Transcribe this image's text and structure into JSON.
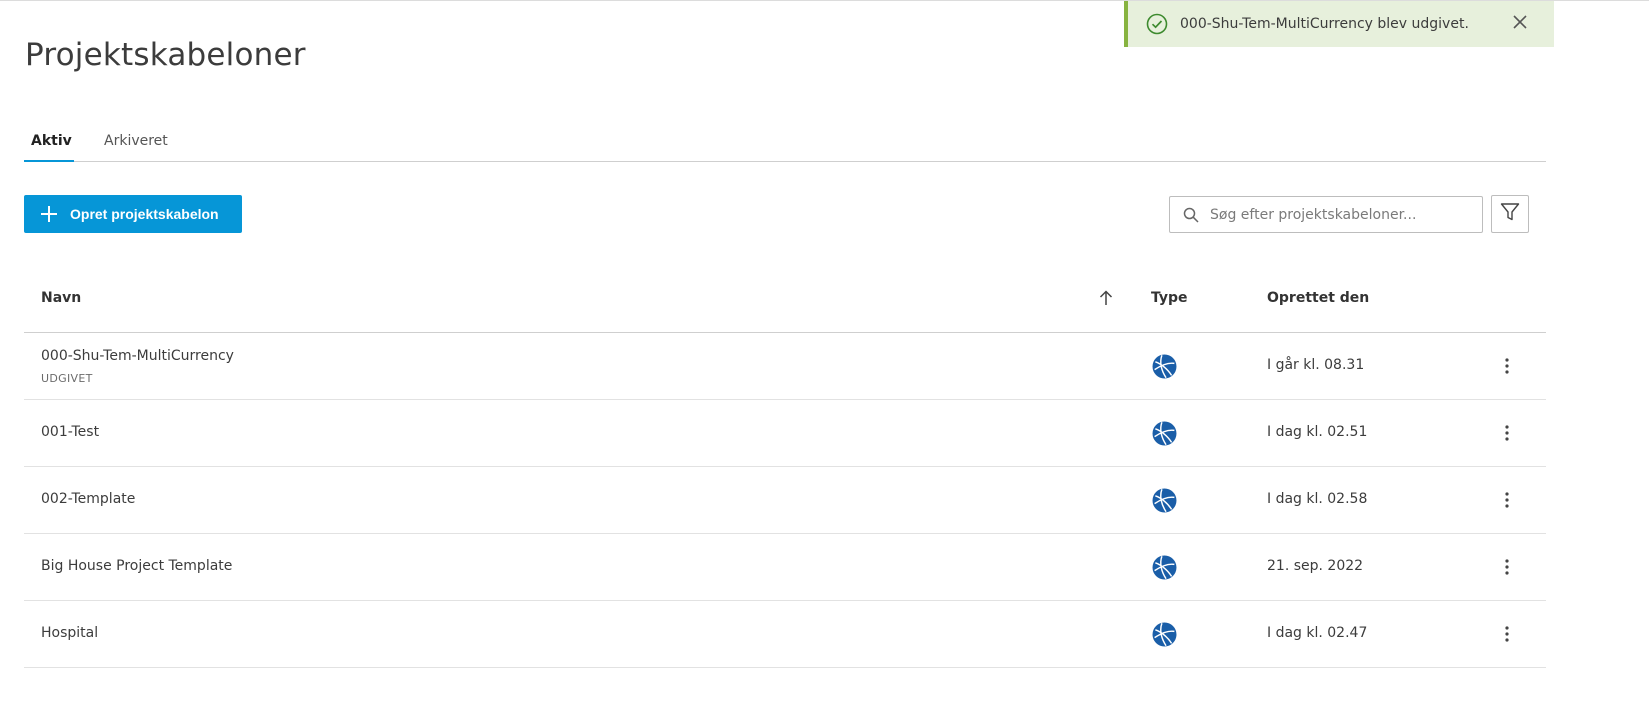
{
  "page": {
    "title": "Projektskabeloner"
  },
  "tabs": [
    {
      "label": "Aktiv",
      "active": true
    },
    {
      "label": "Arkiveret",
      "active": false
    }
  ],
  "toolbar": {
    "create_label": "Opret projektskabelon",
    "search_placeholder": "Søg efter projektskabeloner...",
    "search_value": ""
  },
  "table": {
    "headers": {
      "name": "Navn",
      "type": "Type",
      "created": "Oprettet den"
    },
    "rows": [
      {
        "name": "000-Shu-Tem-MultiCurrency",
        "status": "UDGIVET",
        "type_icon": "globe-icon",
        "created": "I går kl. 08.31"
      },
      {
        "name": "001-Test",
        "status": "",
        "type_icon": "globe-icon",
        "created": "I dag kl. 02.51"
      },
      {
        "name": "002-Template",
        "status": "",
        "type_icon": "globe-icon",
        "created": "I dag kl. 02.58"
      },
      {
        "name": "Big House Project Template",
        "status": "",
        "type_icon": "globe-icon",
        "created": "21. sep. 2022"
      },
      {
        "name": "Hospital",
        "status": "",
        "type_icon": "globe-icon",
        "created": "I dag kl. 02.47"
      }
    ]
  },
  "toast": {
    "message": "000-Shu-Tem-MultiCurrency blev udgivet.",
    "type": "success"
  },
  "colors": {
    "accent": "#0696d7",
    "success_bg": "#e7f0dc",
    "success_border": "#87b340",
    "type_icon": "#1a5ea8"
  }
}
